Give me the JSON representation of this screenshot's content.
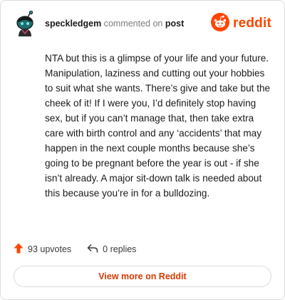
{
  "header": {
    "username": "speckledgem",
    "action_text": "commented on",
    "target_text": "post",
    "brand_wordmark": "reddit"
  },
  "comment": {
    "body": "NTA but this is a glimpse of your life and your future. Manipulation, laziness and cutting out your hobbies to suit what she wants. There’s give and take but the cheek of it! If I were you, I’d definitely stop having sex, but if you can’t manage that, then take extra care with birth control and any ‘accidents’ that may happen in the next couple months because she’s going to be pregnant before the year is out - if she isn’t already. A major sit-down talk is needed about this because you’re in for a bulldozing."
  },
  "footer": {
    "upvotes_label": "93 upvotes",
    "replies_label": "0 replies"
  },
  "view_more_label": "View more on Reddit",
  "colors": {
    "brand": "#ff4500",
    "link": "#d93a00",
    "border": "#dcdcdc"
  },
  "icons": {
    "avatar": "snoo-avatar",
    "brand": "reddit-logo-icon",
    "upvote": "upvote-arrow-icon",
    "reply": "reply-arrow-icon"
  }
}
